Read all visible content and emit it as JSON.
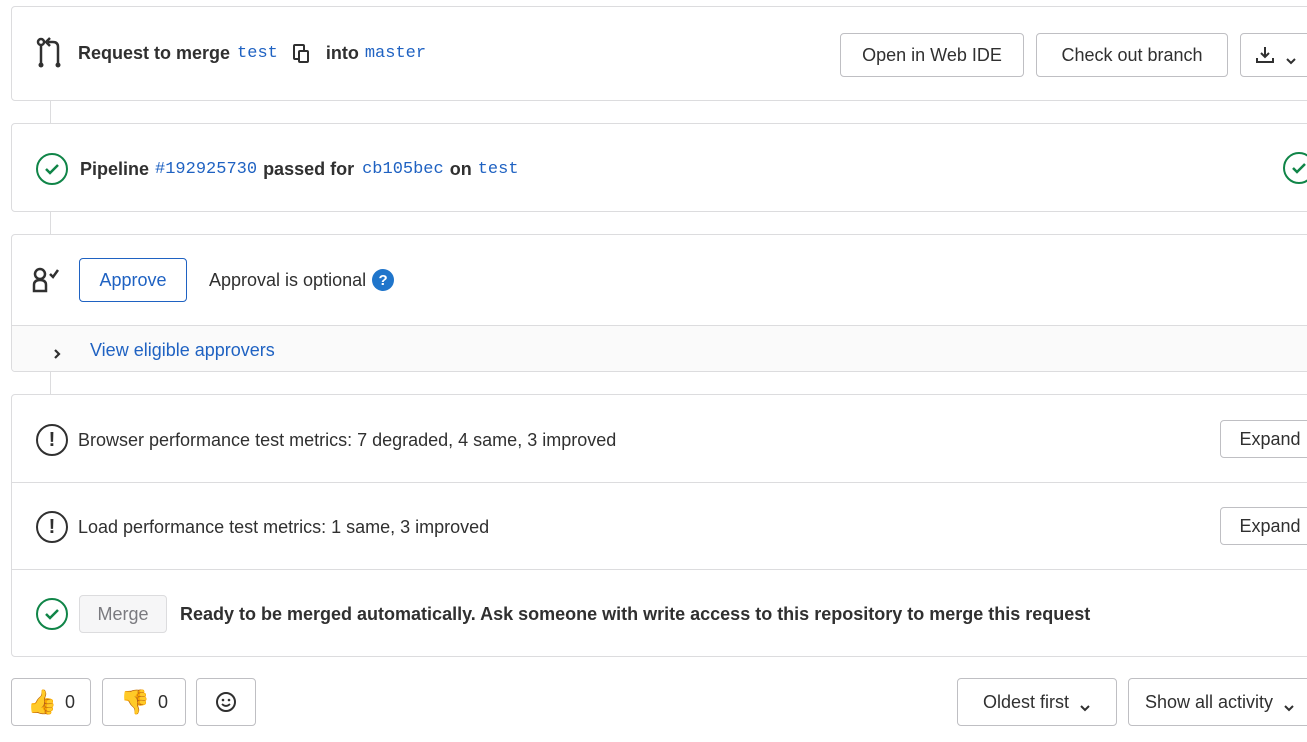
{
  "header": {
    "prefix": "Request to merge",
    "source_branch": "test",
    "middle": "into",
    "target_branch": "master",
    "open_ide_label": "Open in Web IDE",
    "checkout_label": "Check out branch"
  },
  "pipeline": {
    "label": "Pipeline",
    "id": "#192925730",
    "passed_for": "passed for",
    "commit": "cb105bec",
    "on": "on",
    "branch": "test"
  },
  "approval": {
    "approve_label": "Approve",
    "optional_text": "Approval is optional",
    "help_glyph": "?",
    "view_approvers": "View eligible approvers"
  },
  "metrics": [
    {
      "text": "Browser performance test metrics: 7 degraded, 4 same, 3 improved",
      "expand_label": "Expand"
    },
    {
      "text": "Load performance test metrics: 1 same, 3 improved",
      "expand_label": "Expand"
    }
  ],
  "merge": {
    "button_label": "Merge",
    "status_text": "Ready to be merged automatically. Ask someone with write access to this repository to merge this request"
  },
  "reactions": {
    "thumbsup_emoji": "👍",
    "thumbsup_count": "0",
    "thumbsdown_emoji": "👎",
    "thumbsdown_count": "0"
  },
  "activity": {
    "sort_label": "Oldest first",
    "filter_label": "Show all activity"
  },
  "colors": {
    "link": "#1f62c2",
    "success": "#108548",
    "border": "#dcdcde",
    "help": "#1f75cb"
  },
  "icons": [
    "merge-request-icon",
    "copy-icon",
    "download-icon",
    "chevron-down-icon",
    "status-success-icon",
    "approval-icon",
    "question-icon",
    "chevron-right-icon",
    "warning-icon",
    "smiley-icon"
  ]
}
